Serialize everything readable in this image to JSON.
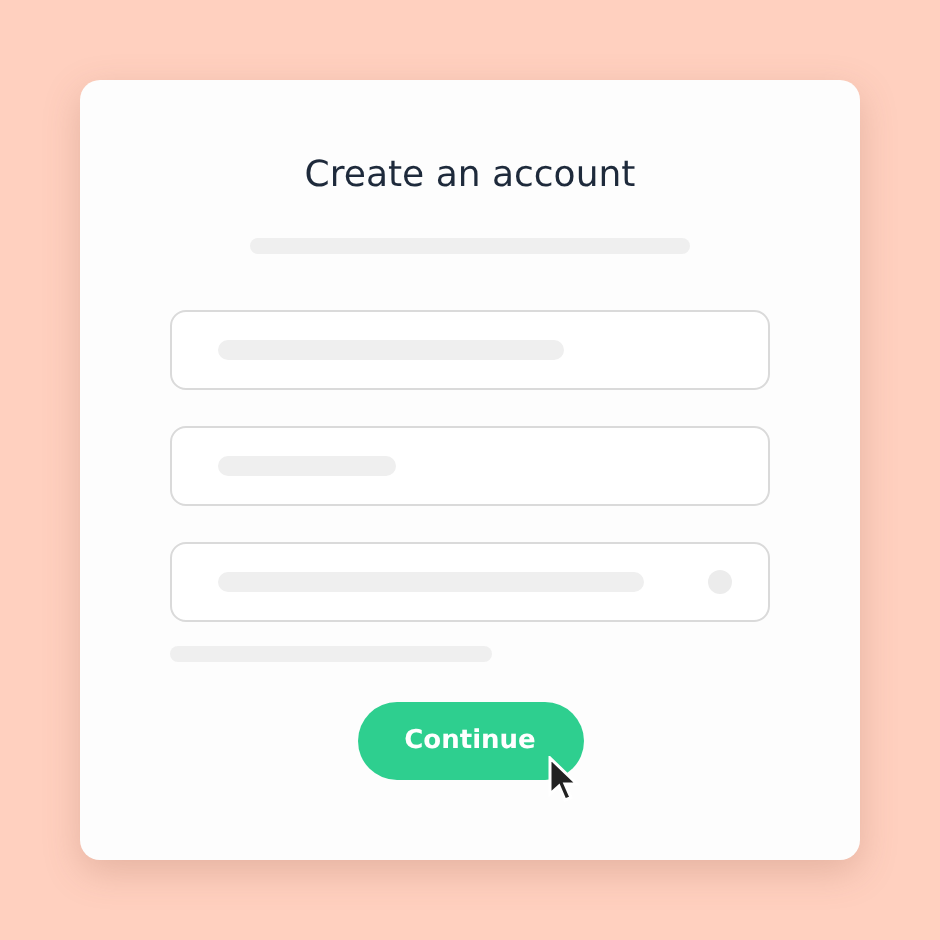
{
  "card": {
    "title": "Create an account"
  },
  "fields": [
    {
      "kind": "plain"
    },
    {
      "kind": "plain"
    },
    {
      "kind": "with-dot"
    }
  ],
  "button": {
    "label": "Continue"
  }
}
